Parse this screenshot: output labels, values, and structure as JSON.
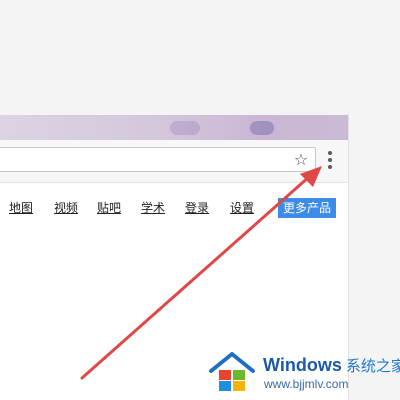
{
  "toolbar": {
    "bookmark_icon": "star-icon",
    "menu_icon": "three-dots-menu-icon"
  },
  "nav": {
    "links": [
      "地图",
      "视频",
      "贴吧",
      "学术",
      "登录",
      "设置"
    ],
    "more_products": "更多产品"
  },
  "annotation": {
    "arrow_color": "#e04848"
  },
  "watermark": {
    "brand": "Windows",
    "brand_cn": "系统之家",
    "url": "www.bjjmlv.com"
  }
}
